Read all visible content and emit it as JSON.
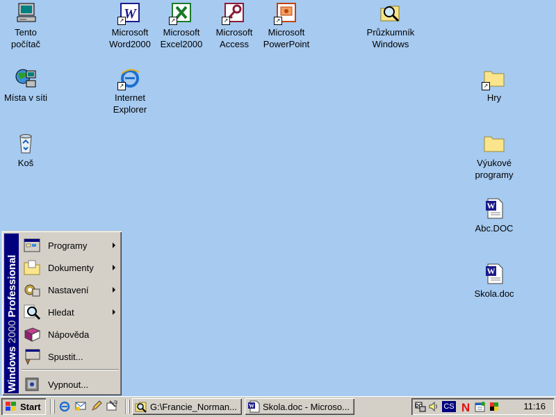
{
  "desktop": {
    "icons": [
      {
        "label": "Tento\npočítač"
      },
      {
        "label": "Místa v síti"
      },
      {
        "label": "Koš"
      },
      {
        "label": "Microsoft\nWord2000"
      },
      {
        "label": "Internet\nExplorer"
      },
      {
        "label": "Microsoft\nExcel2000"
      },
      {
        "label": "Microsoft\nAccess"
      },
      {
        "label": "Microsoft\nPowerPoint"
      },
      {
        "label": "Průzkumník\nWindows"
      },
      {
        "label": "Hry"
      },
      {
        "label": "Výukové\nprogramy"
      },
      {
        "label": "Abc.DOC"
      },
      {
        "label": "Skola.doc"
      }
    ]
  },
  "start_menu": {
    "banner_bold": "Windows",
    "banner_light": "2000",
    "banner_bold2": "Professional",
    "items": [
      {
        "label": "Programy",
        "submenu": true
      },
      {
        "label": "Dokumenty",
        "submenu": true
      },
      {
        "label": "Nastavení",
        "submenu": true
      },
      {
        "label": "Hledat",
        "submenu": true
      },
      {
        "label": "Nápověda",
        "submenu": false
      },
      {
        "label": "Spustit...",
        "submenu": false
      },
      {
        "label": "Vypnout...",
        "submenu": false
      }
    ]
  },
  "taskbar": {
    "start_label": "Start",
    "tasks": [
      {
        "label": "G:\\Francie_Norman..."
      },
      {
        "label": "Skola.doc - Microso..."
      }
    ],
    "tray": {
      "language": "CS",
      "clock": "11:16"
    }
  },
  "colors": {
    "desktop": "#a6caf0",
    "face": "#d4d0c8",
    "banner": "#00007f"
  }
}
